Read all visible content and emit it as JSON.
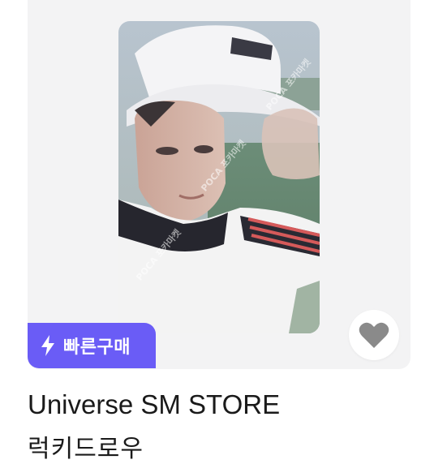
{
  "product": {
    "image_alt_icon": "photocard-image",
    "watermark": "POCA 포카마켓",
    "quick_buy_label": "빠른구매",
    "title": "Universe SM STORE",
    "subtitle": "럭키드로우"
  },
  "colors": {
    "card_bg": "#f3f3f4",
    "badge_bg": "#6a5cf6",
    "heart": "#8a8a8a",
    "text": "#1a1a1a"
  }
}
